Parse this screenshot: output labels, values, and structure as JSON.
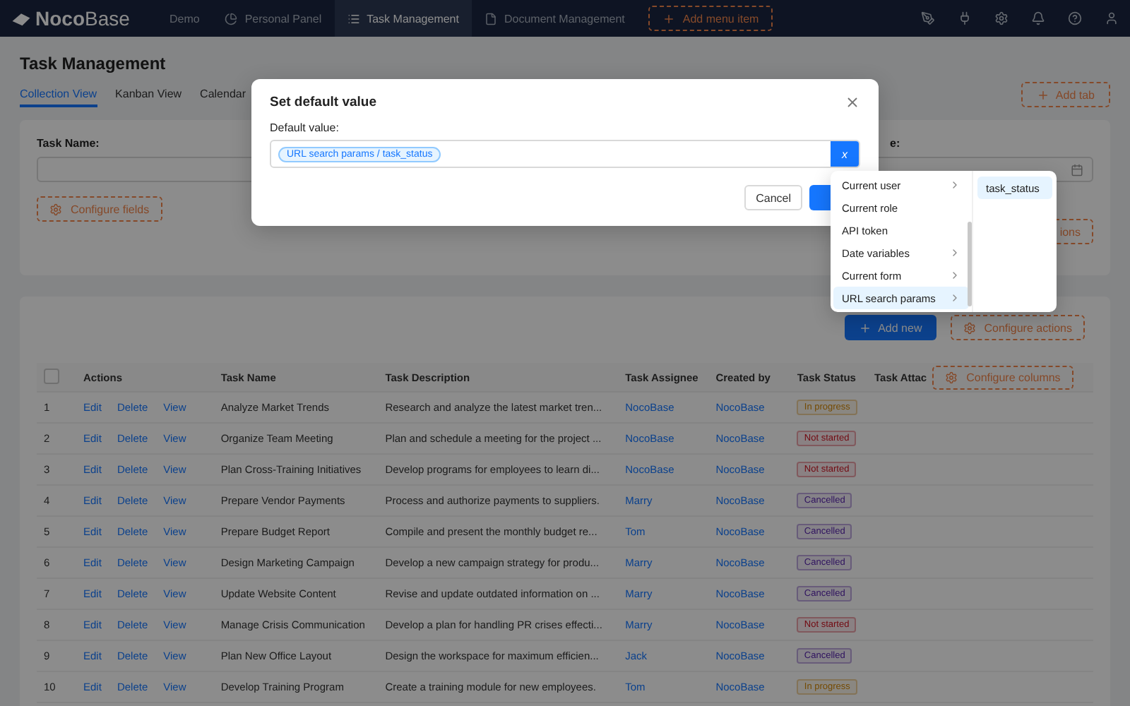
{
  "nav": {
    "logo": "**Noco**Base",
    "items": [
      {
        "label": "Demo",
        "selected": false
      },
      {
        "label": "Personal Panel",
        "selected": false
      },
      {
        "label": "Task Management",
        "selected": true
      },
      {
        "label": "Document Management",
        "selected": false
      }
    ],
    "add_item": "Add menu item"
  },
  "page": {
    "title": "Task Management",
    "tabs": [
      {
        "label": "Collection View",
        "selected": true
      },
      {
        "label": "Kanban View",
        "selected": false
      },
      {
        "label": "Calendar",
        "selected": false
      }
    ],
    "add_tab": "Add tab"
  },
  "filter": {
    "fields": [
      {
        "label": "Task Name:",
        "kind": "text"
      },
      {
        "label": "e:",
        "kind": "date"
      }
    ],
    "configure_fields": "Configure fields",
    "action_partial": "ions"
  },
  "table": {
    "add_new": "Add new",
    "configure_actions": "Configure actions",
    "select_all_checked": false,
    "columns": [
      "Actions",
      "Task Name",
      "Task Description",
      "Task Assignee",
      "Created by",
      "Task Status",
      "Task Attac"
    ],
    "configure_columns": "Configure columns",
    "rows": [
      {
        "index": "1",
        "actions": [
          "Edit",
          "Delete",
          "View"
        ],
        "name": "Analyze Market Trends",
        "description": "Research and analyze the latest market tren...",
        "assignee": "NocoBase",
        "created_by": "NocoBase",
        "status": "In progress",
        "kind": "progress"
      },
      {
        "index": "2",
        "actions": [
          "Edit",
          "Delete",
          "View"
        ],
        "name": "Organize Team Meeting",
        "description": "Plan and schedule a meeting for the project ...",
        "assignee": "NocoBase",
        "created_by": "NocoBase",
        "status": "Not started",
        "kind": "todo"
      },
      {
        "index": "3",
        "actions": [
          "Edit",
          "Delete",
          "View"
        ],
        "name": "Plan Cross-Training Initiatives",
        "description": "Develop programs for employees to learn di...",
        "assignee": "NocoBase",
        "created_by": "NocoBase",
        "status": "Not started",
        "kind": "todo"
      },
      {
        "index": "4",
        "actions": [
          "Edit",
          "Delete",
          "View"
        ],
        "name": "Prepare Vendor Payments",
        "description": "Process and authorize payments to suppliers.",
        "assignee": "Marry",
        "created_by": "NocoBase",
        "status": "Cancelled",
        "kind": "cancelled"
      },
      {
        "index": "5",
        "actions": [
          "Edit",
          "Delete",
          "View"
        ],
        "name": "Prepare Budget Report",
        "description": "Compile and present the monthly budget re...",
        "assignee": "Tom",
        "created_by": "NocoBase",
        "status": "Cancelled",
        "kind": "cancelled"
      },
      {
        "index": "6",
        "actions": [
          "Edit",
          "Delete",
          "View"
        ],
        "name": "Design Marketing Campaign",
        "description": "Develop a new campaign strategy for produ...",
        "assignee": "Marry",
        "created_by": "NocoBase",
        "status": "Cancelled",
        "kind": "cancelled"
      },
      {
        "index": "7",
        "actions": [
          "Edit",
          "Delete",
          "View"
        ],
        "name": "Update Website Content",
        "description": "Revise and update outdated information on ...",
        "assignee": "Marry",
        "created_by": "NocoBase",
        "status": "Cancelled",
        "kind": "cancelled"
      },
      {
        "index": "8",
        "actions": [
          "Edit",
          "Delete",
          "View"
        ],
        "name": "Manage Crisis Communication",
        "description": "Develop a plan for handling PR crises effecti...",
        "assignee": "Marry",
        "created_by": "NocoBase",
        "status": "Not started",
        "kind": "todo"
      },
      {
        "index": "9",
        "actions": [
          "Edit",
          "Delete",
          "View"
        ],
        "name": "Plan New Office Layout",
        "description": "Design the workspace for maximum efficien...",
        "assignee": "Jack",
        "created_by": "NocoBase",
        "status": "Cancelled",
        "kind": "cancelled"
      },
      {
        "index": "10",
        "actions": [
          "Edit",
          "Delete",
          "View"
        ],
        "name": "Develop Training Program",
        "description": "Create a training module for new employees.",
        "assignee": "Tom",
        "created_by": "NocoBase",
        "status": "In progress",
        "kind": "progress"
      }
    ]
  },
  "modal": {
    "title": "Set default value",
    "field_label": "Default value:",
    "tag": "URL search params / task_status",
    "variable_button": "x",
    "cancel": "Cancel"
  },
  "dropdown": {
    "items": [
      {
        "label": "Current user",
        "has_children": true,
        "selected": false
      },
      {
        "label": "Current role",
        "has_children": false,
        "selected": false
      },
      {
        "label": "API token",
        "has_children": false,
        "selected": false
      },
      {
        "label": "Date variables",
        "has_children": true,
        "selected": false
      },
      {
        "label": "Current form",
        "has_children": true,
        "selected": false
      },
      {
        "label": "URL search params",
        "has_children": true,
        "selected": true
      }
    ],
    "sub_items": [
      {
        "label": "task_status",
        "selected": true
      }
    ]
  }
}
